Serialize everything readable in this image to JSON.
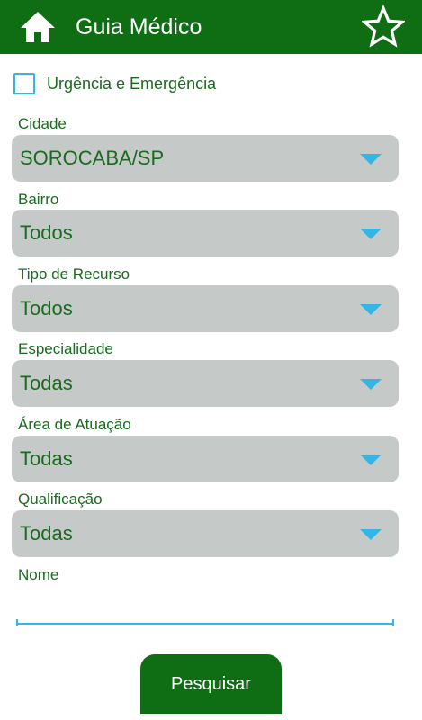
{
  "header": {
    "title": "Guia Médico",
    "home_icon": "home-icon",
    "favorite_icon": "star-icon",
    "background_color": "#0f6e14"
  },
  "emergency": {
    "label": "Urgência e Emergência",
    "checked": false
  },
  "fields": {
    "cidade": {
      "label": "Cidade",
      "value": "SOROCABA/SP"
    },
    "bairro": {
      "label": "Bairro",
      "value": "Todos"
    },
    "tipo_recurso": {
      "label": "Tipo de Recurso",
      "value": "Todos"
    },
    "especialidade": {
      "label": "Especialidade",
      "value": "Todas"
    },
    "area_atuacao": {
      "label": "Área de Atuação",
      "value": "Todas"
    },
    "qualificacao": {
      "label": "Qualificação",
      "value": "Todas"
    }
  },
  "nome": {
    "label": "Nome",
    "value": ""
  },
  "search_button": {
    "label": "Pesquisar"
  },
  "colors": {
    "primary": "#0f6e14",
    "accent": "#33b5e5",
    "select_background": "#c5c9c8",
    "text": "#1a6b1f"
  }
}
